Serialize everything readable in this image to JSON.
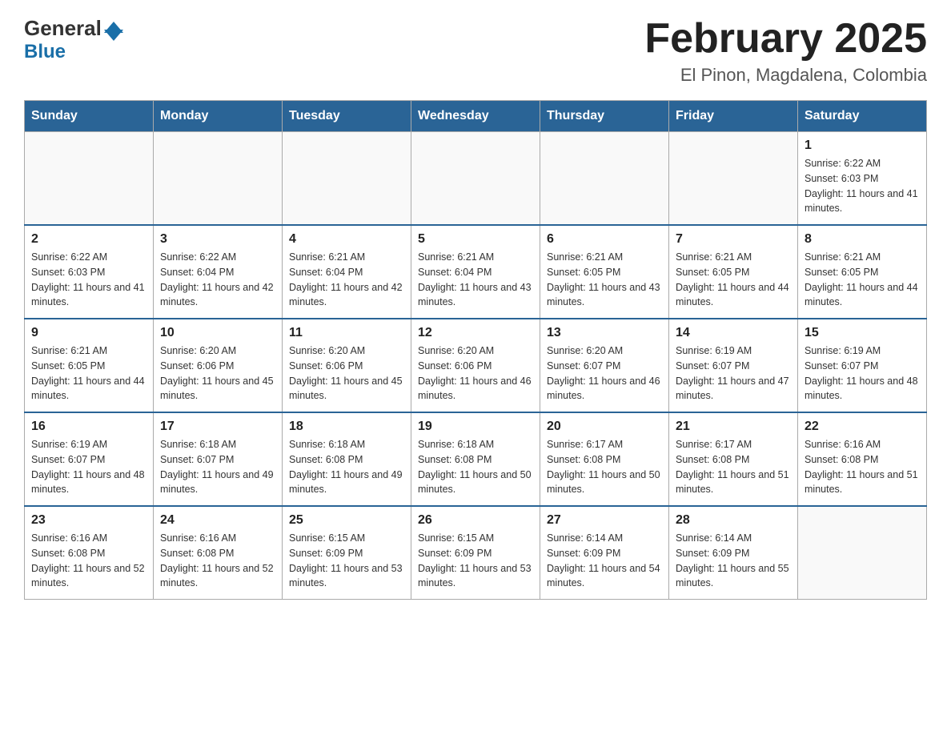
{
  "header": {
    "logo_general": "General",
    "logo_blue": "Blue",
    "month_title": "February 2025",
    "location": "El Pinon, Magdalena, Colombia"
  },
  "weekdays": [
    "Sunday",
    "Monday",
    "Tuesday",
    "Wednesday",
    "Thursday",
    "Friday",
    "Saturday"
  ],
  "weeks": [
    [
      {
        "day": "",
        "sunrise": "",
        "sunset": "",
        "daylight": ""
      },
      {
        "day": "",
        "sunrise": "",
        "sunset": "",
        "daylight": ""
      },
      {
        "day": "",
        "sunrise": "",
        "sunset": "",
        "daylight": ""
      },
      {
        "day": "",
        "sunrise": "",
        "sunset": "",
        "daylight": ""
      },
      {
        "day": "",
        "sunrise": "",
        "sunset": "",
        "daylight": ""
      },
      {
        "day": "",
        "sunrise": "",
        "sunset": "",
        "daylight": ""
      },
      {
        "day": "1",
        "sunrise": "Sunrise: 6:22 AM",
        "sunset": "Sunset: 6:03 PM",
        "daylight": "Daylight: 11 hours and 41 minutes."
      }
    ],
    [
      {
        "day": "2",
        "sunrise": "Sunrise: 6:22 AM",
        "sunset": "Sunset: 6:03 PM",
        "daylight": "Daylight: 11 hours and 41 minutes."
      },
      {
        "day": "3",
        "sunrise": "Sunrise: 6:22 AM",
        "sunset": "Sunset: 6:04 PM",
        "daylight": "Daylight: 11 hours and 42 minutes."
      },
      {
        "day": "4",
        "sunrise": "Sunrise: 6:21 AM",
        "sunset": "Sunset: 6:04 PM",
        "daylight": "Daylight: 11 hours and 42 minutes."
      },
      {
        "day": "5",
        "sunrise": "Sunrise: 6:21 AM",
        "sunset": "Sunset: 6:04 PM",
        "daylight": "Daylight: 11 hours and 43 minutes."
      },
      {
        "day": "6",
        "sunrise": "Sunrise: 6:21 AM",
        "sunset": "Sunset: 6:05 PM",
        "daylight": "Daylight: 11 hours and 43 minutes."
      },
      {
        "day": "7",
        "sunrise": "Sunrise: 6:21 AM",
        "sunset": "Sunset: 6:05 PM",
        "daylight": "Daylight: 11 hours and 44 minutes."
      },
      {
        "day": "8",
        "sunrise": "Sunrise: 6:21 AM",
        "sunset": "Sunset: 6:05 PM",
        "daylight": "Daylight: 11 hours and 44 minutes."
      }
    ],
    [
      {
        "day": "9",
        "sunrise": "Sunrise: 6:21 AM",
        "sunset": "Sunset: 6:05 PM",
        "daylight": "Daylight: 11 hours and 44 minutes."
      },
      {
        "day": "10",
        "sunrise": "Sunrise: 6:20 AM",
        "sunset": "Sunset: 6:06 PM",
        "daylight": "Daylight: 11 hours and 45 minutes."
      },
      {
        "day": "11",
        "sunrise": "Sunrise: 6:20 AM",
        "sunset": "Sunset: 6:06 PM",
        "daylight": "Daylight: 11 hours and 45 minutes."
      },
      {
        "day": "12",
        "sunrise": "Sunrise: 6:20 AM",
        "sunset": "Sunset: 6:06 PM",
        "daylight": "Daylight: 11 hours and 46 minutes."
      },
      {
        "day": "13",
        "sunrise": "Sunrise: 6:20 AM",
        "sunset": "Sunset: 6:07 PM",
        "daylight": "Daylight: 11 hours and 46 minutes."
      },
      {
        "day": "14",
        "sunrise": "Sunrise: 6:19 AM",
        "sunset": "Sunset: 6:07 PM",
        "daylight": "Daylight: 11 hours and 47 minutes."
      },
      {
        "day": "15",
        "sunrise": "Sunrise: 6:19 AM",
        "sunset": "Sunset: 6:07 PM",
        "daylight": "Daylight: 11 hours and 48 minutes."
      }
    ],
    [
      {
        "day": "16",
        "sunrise": "Sunrise: 6:19 AM",
        "sunset": "Sunset: 6:07 PM",
        "daylight": "Daylight: 11 hours and 48 minutes."
      },
      {
        "day": "17",
        "sunrise": "Sunrise: 6:18 AM",
        "sunset": "Sunset: 6:07 PM",
        "daylight": "Daylight: 11 hours and 49 minutes."
      },
      {
        "day": "18",
        "sunrise": "Sunrise: 6:18 AM",
        "sunset": "Sunset: 6:08 PM",
        "daylight": "Daylight: 11 hours and 49 minutes."
      },
      {
        "day": "19",
        "sunrise": "Sunrise: 6:18 AM",
        "sunset": "Sunset: 6:08 PM",
        "daylight": "Daylight: 11 hours and 50 minutes."
      },
      {
        "day": "20",
        "sunrise": "Sunrise: 6:17 AM",
        "sunset": "Sunset: 6:08 PM",
        "daylight": "Daylight: 11 hours and 50 minutes."
      },
      {
        "day": "21",
        "sunrise": "Sunrise: 6:17 AM",
        "sunset": "Sunset: 6:08 PM",
        "daylight": "Daylight: 11 hours and 51 minutes."
      },
      {
        "day": "22",
        "sunrise": "Sunrise: 6:16 AM",
        "sunset": "Sunset: 6:08 PM",
        "daylight": "Daylight: 11 hours and 51 minutes."
      }
    ],
    [
      {
        "day": "23",
        "sunrise": "Sunrise: 6:16 AM",
        "sunset": "Sunset: 6:08 PM",
        "daylight": "Daylight: 11 hours and 52 minutes."
      },
      {
        "day": "24",
        "sunrise": "Sunrise: 6:16 AM",
        "sunset": "Sunset: 6:08 PM",
        "daylight": "Daylight: 11 hours and 52 minutes."
      },
      {
        "day": "25",
        "sunrise": "Sunrise: 6:15 AM",
        "sunset": "Sunset: 6:09 PM",
        "daylight": "Daylight: 11 hours and 53 minutes."
      },
      {
        "day": "26",
        "sunrise": "Sunrise: 6:15 AM",
        "sunset": "Sunset: 6:09 PM",
        "daylight": "Daylight: 11 hours and 53 minutes."
      },
      {
        "day": "27",
        "sunrise": "Sunrise: 6:14 AM",
        "sunset": "Sunset: 6:09 PM",
        "daylight": "Daylight: 11 hours and 54 minutes."
      },
      {
        "day": "28",
        "sunrise": "Sunrise: 6:14 AM",
        "sunset": "Sunset: 6:09 PM",
        "daylight": "Daylight: 11 hours and 55 minutes."
      },
      {
        "day": "",
        "sunrise": "",
        "sunset": "",
        "daylight": ""
      }
    ]
  ]
}
